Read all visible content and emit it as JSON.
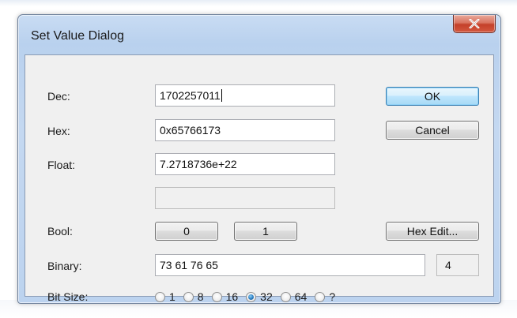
{
  "dialog": {
    "title": "Set Value Dialog",
    "close_icon": "close-x-icon"
  },
  "fields": {
    "dec": {
      "label": "Dec:",
      "value": "1702257011"
    },
    "hex": {
      "label": "Hex:",
      "value": "0x65766173"
    },
    "float": {
      "label": "Float:",
      "value": "7.2718736e+22"
    },
    "extra": {
      "value": ""
    },
    "bool": {
      "label": "Bool:"
    },
    "binary": {
      "label": "Binary:",
      "value": "73 61 76 65",
      "byte_count": "4"
    },
    "bit_size": {
      "label": "Bit Size:"
    }
  },
  "buttons": {
    "ok": "OK",
    "cancel": "Cancel",
    "bool_0": "0",
    "bool_1": "1",
    "hex_edit": "Hex Edit..."
  },
  "bit_size_options": {
    "opt_1": "1",
    "opt_8": "8",
    "opt_16": "16",
    "opt_32": "32",
    "opt_64": "64",
    "opt_q": "?",
    "selected": "32"
  }
}
